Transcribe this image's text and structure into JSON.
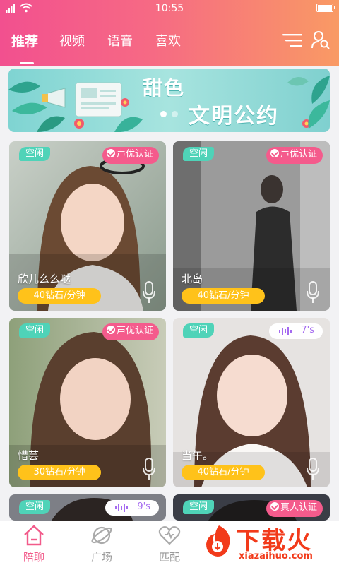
{
  "status_bar": {
    "time": "10:55"
  },
  "header": {
    "tabs": [
      {
        "label": "推荐",
        "active": true
      },
      {
        "label": "视频",
        "active": false
      },
      {
        "label": "语音",
        "active": false
      },
      {
        "label": "喜欢",
        "active": false
      }
    ],
    "icons": [
      "menu-icon",
      "user-search-icon"
    ]
  },
  "banner": {
    "subtitle": "甜色",
    "title": "文明公约",
    "page_indicator": {
      "total": 2,
      "current": 1
    }
  },
  "cards": [
    {
      "status": "空闲",
      "badge_type": "cert",
      "badge": "声优认证",
      "name": "欣儿么么哒",
      "price": "40钻石/分钟"
    },
    {
      "status": "空闲",
      "badge_type": "cert",
      "badge": "声优认证",
      "name": "北岛",
      "price": "40钻石/分钟"
    },
    {
      "status": "空闲",
      "badge_type": "cert",
      "badge": "声优认证",
      "name": "惜芸",
      "price": "30钻石/分钟"
    },
    {
      "status": "空闲",
      "badge_type": "voice",
      "badge": "7's",
      "name": "当午。",
      "price": "40钻石/分钟"
    },
    {
      "status": "空闲",
      "badge_type": "voice",
      "badge": "9's",
      "name": "",
      "price": ""
    },
    {
      "status": "空闲",
      "badge_type": "cert",
      "badge": "真人认证",
      "name": "",
      "price": ""
    }
  ],
  "bottom_nav": [
    {
      "label": "陪聊",
      "icon": "home-icon",
      "active": true
    },
    {
      "label": "广场",
      "icon": "planet-icon",
      "active": false
    },
    {
      "label": "匹配",
      "icon": "heart-icon",
      "active": false
    }
  ],
  "watermark": {
    "text": "下载火",
    "url": "xiazaihuo.com"
  },
  "colors": {
    "accent": "#f25a8a",
    "tag_green": "#4fd3b8",
    "price_yellow": "#ffc21a",
    "header_start": "#f2508f",
    "header_end": "#f99a64"
  }
}
